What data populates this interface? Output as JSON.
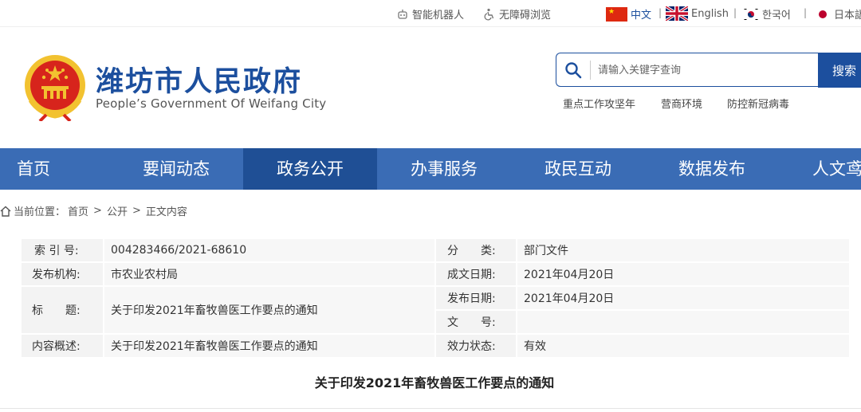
{
  "topbar": {
    "robot": "智能机器人",
    "accessible": "无障碍浏览",
    "lang_zh": "中文",
    "lang_en": "English",
    "lang_ko": "한국어",
    "lang_ja": "日本語",
    "separator": "|"
  },
  "header": {
    "title": "潍坊市人民政府",
    "subtitle": "People’s Government Of Weifang City",
    "search_placeholder": "请输入关键字查询",
    "search_button": "搜索",
    "hot_links": [
      "重点工作攻坚年",
      "营商环境",
      "防控新冠病毒"
    ]
  },
  "nav": {
    "items": [
      "首页",
      "要闻动态",
      "政务公开",
      "办事服务",
      "政民互动",
      "数据发布",
      "人文鸢都"
    ],
    "active_index": 2
  },
  "breadcrumb": {
    "prefix": "当前位置：",
    "home": "首页",
    "sep": ">",
    "level1": "公开",
    "level2": "正文内容"
  },
  "info": {
    "index_label": "索 引 号:",
    "index_value": "004283466/2021-68610",
    "org_label": "发布机构:",
    "org_value": "市农业农村局",
    "title_label": "标　　题:",
    "title_value": "关于印发2021年畜牧兽医工作要点的通知",
    "summary_label": "内容概述:",
    "summary_value": "关于印发2021年畜牧兽医工作要点的通知",
    "category_label": "分　　类:",
    "category_value": "部门文件",
    "created_label": "成文日期:",
    "created_value": "2021年04月20日",
    "published_label": "发布日期:",
    "published_value": "2021年04月20日",
    "docno_label": "文　　号:",
    "docno_value": "",
    "status_label": "效力状态:",
    "status_value": "有效"
  },
  "article": {
    "title": "关于印发2021年畜牧兽医工作要点的通知"
  },
  "colors": {
    "brand_blue": "#1c4f9e",
    "nav_blue": "#3a6cb5",
    "nav_active": "#1f4f95",
    "emblem_red": "#d7241c",
    "emblem_gold": "#f2c230"
  }
}
